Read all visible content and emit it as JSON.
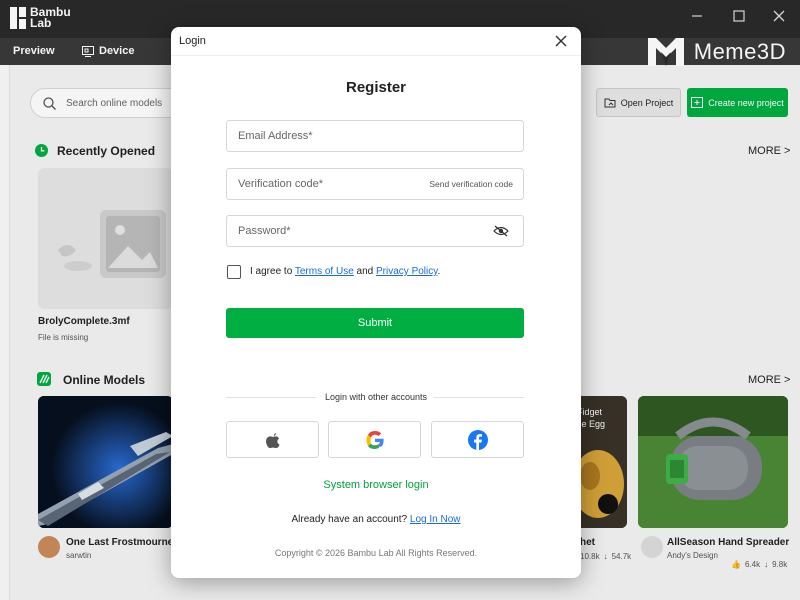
{
  "app": {
    "logo_line1": "Bambu",
    "logo_line2": "Lab",
    "brand_watermark": "Meme3D"
  },
  "tabs": [
    {
      "label": "Preview"
    },
    {
      "label": "Device"
    }
  ],
  "search": {
    "placeholder": "Search online models"
  },
  "toolbar": {
    "open_project": "Open Project",
    "create_project": "Create new project"
  },
  "recent": {
    "title": "Recently Opened",
    "more": "MORE >",
    "items": [
      {
        "name": "BrolyComplete.3mf",
        "status": "File is missing"
      }
    ]
  },
  "online": {
    "title": "Online Models",
    "more": "MORE >",
    "items": [
      {
        "name": "One Last Frostmourne",
        "author": "sarwtin"
      },
      {
        "name": "y Fidget",
        "name2": "cale Egg",
        "name_below": "het",
        "likes": "10.8k",
        "downloads": "54.7k"
      },
      {
        "name": "AllSeason Hand Spreader",
        "author": "Andy's Design",
        "likes": "6.4k",
        "downloads": "9.8k"
      }
    ]
  },
  "login": {
    "window_title": "Login",
    "heading": "Register",
    "email_placeholder": "Email Address*",
    "code_placeholder": "Verification code*",
    "send_code": "Send verification code",
    "password_placeholder": "Password*",
    "agree_prefix": "I agree to ",
    "terms": "Terms of Use",
    "and": " and ",
    "privacy": "Privacy Policy",
    "period": ".",
    "submit": "Submit",
    "other_accounts": "Login with other accounts",
    "browser_login": "System browser login",
    "already": "Already have an account? ",
    "login_now": "Log In Now",
    "copyright": "Copyright © 2026 Bambu Lab All Rights Reserved."
  },
  "colors": {
    "accent_green": "#00ae42",
    "link_blue": "#1a6bd6",
    "titlebar": "#2a2a2a"
  }
}
